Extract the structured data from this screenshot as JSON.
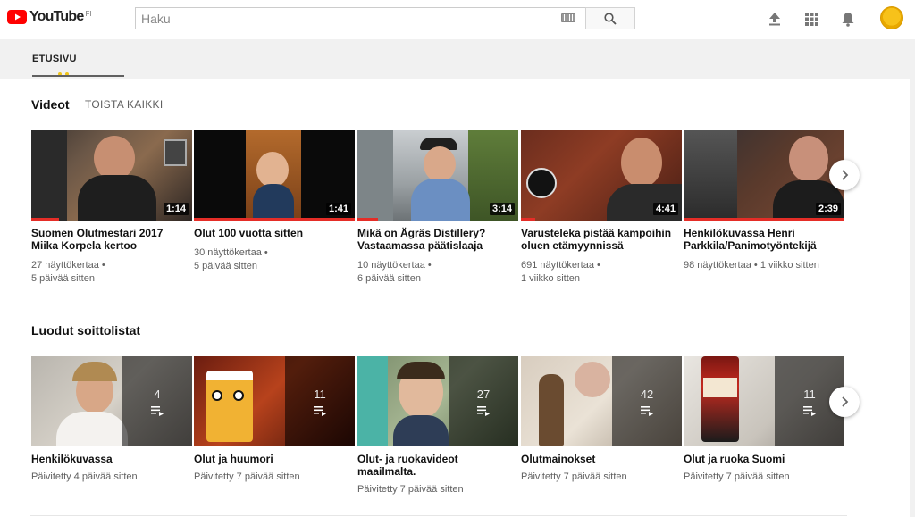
{
  "masthead": {
    "logo_text": "YouTube",
    "country_code": "FI",
    "search_placeholder": "Haku"
  },
  "channel_tabs": {
    "active_tab": "ETUSIVU"
  },
  "videos_section": {
    "title": "Videot",
    "play_all": "TOISTA KAIKKI",
    "items": [
      {
        "title": "Suomen Olutmestari 2017 Miika Korpela kertoo",
        "duration": "1:14",
        "views": "27 näyttökertaa",
        "age": "5 päivää sitten",
        "progress": 0.17
      },
      {
        "title": "Olut 100 vuotta sitten",
        "duration": "1:41",
        "views": "30 näyttökertaa",
        "age": "5 päivää sitten",
        "progress": 1.0
      },
      {
        "title": "Mikä on Ägräs Distillery? Vastaamassa päätislaaja",
        "duration": "3:14",
        "views": "10 näyttökertaa",
        "age": "6 päivää sitten",
        "progress": 0.13
      },
      {
        "title": "Varusteleka pistää kampoihin oluen etämyynnissä",
        "duration": "4:41",
        "views": "691 näyttökertaa",
        "age": "1 viikko sitten",
        "progress": 0.09
      },
      {
        "title": "Henkilökuvassa Henri Parkkila/Panimotyöntekijä",
        "duration": "2:39",
        "views": "98 näyttökertaa",
        "age": "1 viikko sitten",
        "progress": 1.0
      }
    ]
  },
  "playlists_section": {
    "title": "Luodut soittolistat",
    "items": [
      {
        "title": "Henkilökuvassa",
        "count": "4",
        "updated": "Päivitetty 4 päivää sitten"
      },
      {
        "title": "Olut ja huumori",
        "count": "11",
        "updated": "Päivitetty 7 päivää sitten"
      },
      {
        "title": "Olut- ja ruokavideot maailmalta.",
        "count": "27",
        "updated": "Päivitetty 7 päivää sitten"
      },
      {
        "title": "Olutmainokset",
        "count": "42",
        "updated": "Päivitetty 7 päivää sitten"
      },
      {
        "title": "Olut ja ruoka Suomi",
        "count": "11",
        "updated": "Päivitetty 7 päivää sitten"
      }
    ]
  },
  "colors": {
    "accent": "#e52d27",
    "text": "#111111",
    "meta": "#606060"
  },
  "icons": [
    "youtube-logo-icon",
    "keyboard-icon",
    "search-icon",
    "upload-icon",
    "apps-grid-icon",
    "notifications-bell-icon",
    "chevron-right-icon",
    "playlist-icon"
  ]
}
